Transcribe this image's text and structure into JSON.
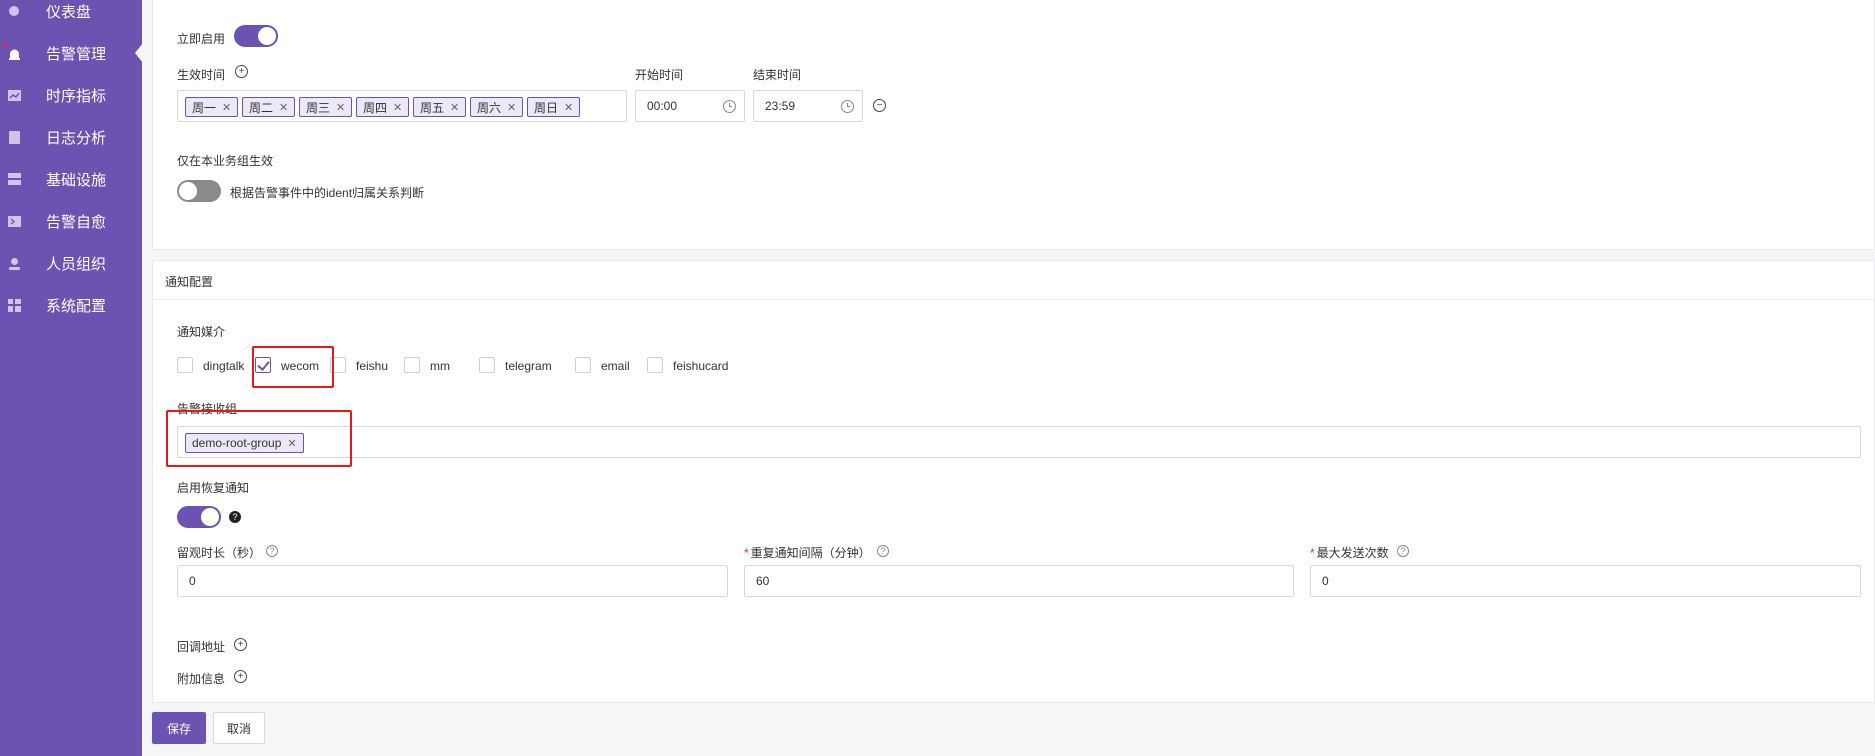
{
  "sidebar": {
    "items": [
      {
        "label": "仪表盘",
        "icon": "dashboard-icon"
      },
      {
        "label": "告警管理",
        "icon": "alarm-icon"
      },
      {
        "label": "时序指标",
        "icon": "chart-icon"
      },
      {
        "label": "日志分析",
        "icon": "log-icon"
      },
      {
        "label": "基础设施",
        "icon": "server-icon"
      },
      {
        "label": "告警自愈",
        "icon": "terminal-icon"
      },
      {
        "label": "人员组织",
        "icon": "user-icon"
      },
      {
        "label": "系统配置",
        "icon": "grid-icon"
      }
    ]
  },
  "schedule": {
    "enable_now_label": "立即启用",
    "effective_time_label": "生效时间",
    "start_time_label": "开始时间",
    "end_time_label": "结束时间",
    "days": [
      "周一",
      "周二",
      "周三",
      "周四",
      "周五",
      "周六",
      "周日"
    ],
    "start_time": "00:00",
    "end_time": "23:59",
    "business_group_only_label": "仅在本业务组生效",
    "business_group_hint": "根据告警事件中的ident归属关系判断"
  },
  "notify": {
    "section_title": "通知配置",
    "media_label": "通知媒介",
    "channels": [
      {
        "label": "dingtalk",
        "checked": false
      },
      {
        "label": "wecom",
        "checked": true
      },
      {
        "label": "feishu",
        "checked": false
      },
      {
        "label": "mm",
        "checked": false
      },
      {
        "label": "telegram",
        "checked": false
      },
      {
        "label": "email",
        "checked": false
      },
      {
        "label": "feishucard",
        "checked": false
      }
    ],
    "receiver_group_label": "告警接收组",
    "receiver_groups": [
      "demo-root-group"
    ],
    "recovery_label": "启用恢复通知",
    "observe_label": "留观时长（秒）",
    "observe_value": "0",
    "repeat_label": "重复通知间隔（分钟）",
    "repeat_value": "60",
    "max_send_label": "最大发送次数",
    "max_send_value": "0",
    "callback_label": "回调地址",
    "extra_label": "附加信息"
  },
  "actions": {
    "save_label": "保存",
    "cancel_label": "取消"
  },
  "colors": {
    "brand": "#6c53b1",
    "highlight": "#e21b1b"
  }
}
